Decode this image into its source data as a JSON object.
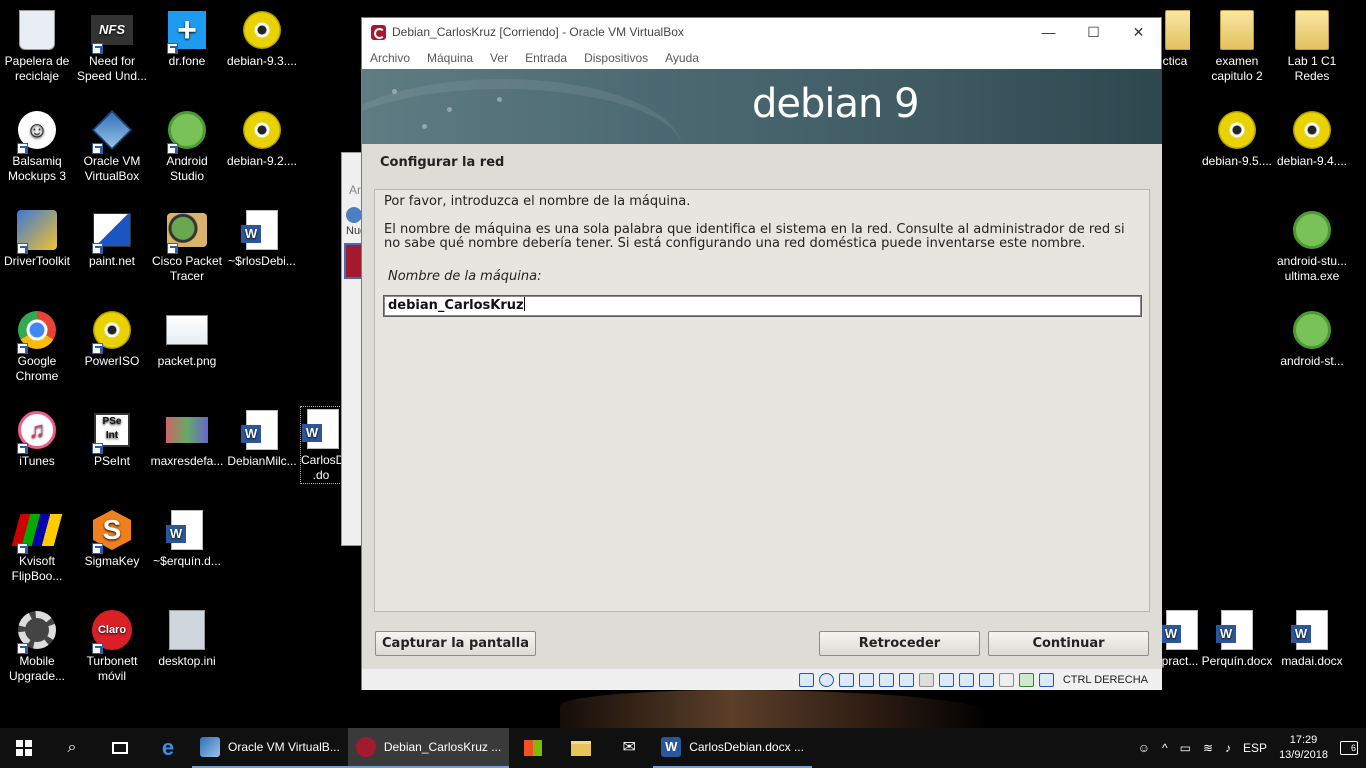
{
  "desktop": {
    "icons": [
      {
        "label": "Papelera de reciclaje",
        "icon": "recycle-bin-icon"
      },
      {
        "label": "Need for Speed Und...",
        "icon": "nfs-icon",
        "text": "NFS"
      },
      {
        "label": "dr.fone",
        "icon": "drfone-icon"
      },
      {
        "label": "debian-9.3....",
        "icon": "disc-image-icon"
      },
      {
        "label": "Balsamiq Mockups 3",
        "icon": "balsamiq-icon"
      },
      {
        "label": "Oracle VM VirtualBox",
        "icon": "virtualbox-icon"
      },
      {
        "label": "Android Studio",
        "icon": "android-studio-icon"
      },
      {
        "label": "debian-9.2....",
        "icon": "disc-image-icon"
      },
      {
        "label": "DriverToolkit",
        "icon": "driver-toolkit-icon"
      },
      {
        "label": "paint.net",
        "icon": "paint-net-icon"
      },
      {
        "label": "Cisco Packet Tracer",
        "icon": "packet-tracer-icon"
      },
      {
        "label": "~$rlosDebi...",
        "icon": "word-doc-icon"
      },
      {
        "label": "Google Chrome",
        "icon": "chrome-icon"
      },
      {
        "label": "PowerISO",
        "icon": "poweriso-icon"
      },
      {
        "label": "packet.png",
        "icon": "image-file-icon"
      },
      {
        "label": "iTunes",
        "icon": "itunes-icon"
      },
      {
        "label": "PSeInt",
        "icon": "pseint-icon",
        "text": "PSe Int"
      },
      {
        "label": "maxresdefa...",
        "icon": "image-file-icon"
      },
      {
        "label": "DebianMilc...",
        "icon": "word-doc-icon"
      },
      {
        "label": "CarlosD .do",
        "icon": "word-doc-icon"
      },
      {
        "label": "Kvisoft FlipBoo...",
        "icon": "kvisoft-icon"
      },
      {
        "label": "SigmaKey",
        "icon": "sigmakey-icon",
        "text": "S"
      },
      {
        "label": "~$erquín.d...",
        "icon": "word-doc-icon"
      },
      {
        "label": "Mobile Upgrade...",
        "icon": "mobile-upgrade-icon"
      },
      {
        "label": "Turbonett móvil",
        "icon": "claro-icon",
        "text": "Claro"
      },
      {
        "label": "desktop.ini",
        "icon": "settings-file-icon"
      },
      {
        "label": "ctica",
        "icon": "folder-icon"
      },
      {
        "label": "examen capitulo 2",
        "icon": "folder-icon"
      },
      {
        "label": "Lab 1 C1 Redes",
        "icon": "folder-icon"
      },
      {
        "label": "debian-9.5....",
        "icon": "disc-image-icon"
      },
      {
        "label": "debian-9.4....",
        "icon": "disc-image-icon"
      },
      {
        "label": "android-stu... ultima.exe",
        "icon": "android-studio-icon"
      },
      {
        "label": "android-st...",
        "icon": "android-studio-icon"
      },
      {
        "label": "pract...",
        "icon": "word-doc-icon"
      },
      {
        "label": "Perquín.docx",
        "icon": "word-doc-icon"
      },
      {
        "label": "madai.docx",
        "icon": "word-doc-icon"
      }
    ]
  },
  "bg_window": {
    "frag1": "Ar",
    "frag2": "Nue"
  },
  "vbox": {
    "title": "Debian_CarlosKruz [Corriendo] - Oracle VM VirtualBox",
    "window_controls": {
      "minimize": "—",
      "maximize": "☐",
      "close": "✕"
    },
    "menu": [
      "Archivo",
      "Máquina",
      "Ver",
      "Entrada",
      "Dispositivos",
      "Ayuda"
    ],
    "installer": {
      "banner": "debian 9",
      "section_title": "Configurar la red",
      "prompt": "Por favor, introduzca el nombre de la máquina.",
      "description": "El nombre de máquina es una sola palabra que identifica el sistema en la red. Consulte al administrador de red si no sabe qué nombre debería tener. Si está configurando una red doméstica puede inventarse este nombre.",
      "field_label": "Nombre de la máquina:",
      "hostname_value": "debian_CarlosKruz",
      "buttons": {
        "screenshot": "Capturar la pantalla",
        "back": "Retroceder",
        "continue": "Continuar"
      }
    },
    "status": {
      "host_key": "CTRL DERECHA"
    }
  },
  "taskbar": {
    "apps": [
      {
        "label": "Oracle VM VirtualB...",
        "icon": "virtualbox-icon"
      },
      {
        "label": "Debian_CarlosKruz ...",
        "icon": "vm-running-icon"
      },
      {
        "label": "CarlosDebian.docx ...",
        "icon": "word-doc-icon"
      }
    ],
    "language": "ESP",
    "time": "17:29",
    "date": "13/9/2018",
    "notifications": "6"
  }
}
